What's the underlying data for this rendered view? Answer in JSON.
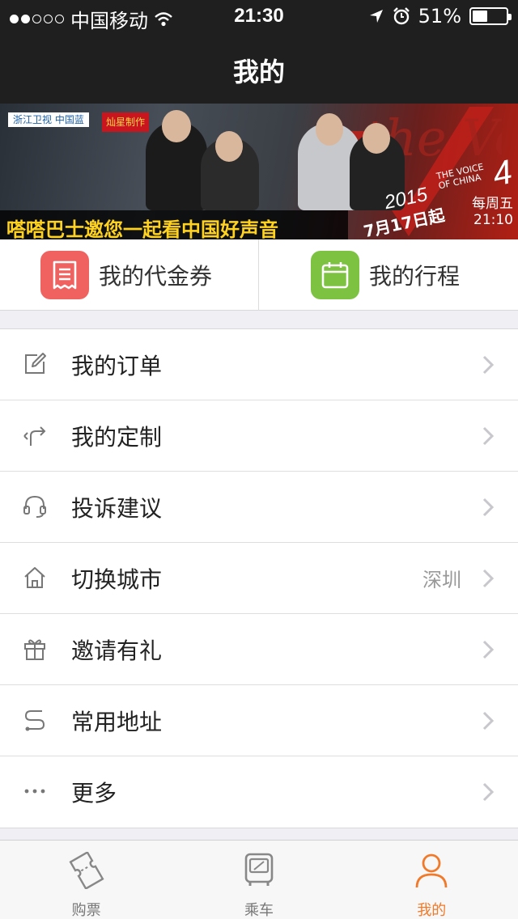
{
  "status_bar": {
    "carrier": "中国移动",
    "time": "21:30",
    "battery": "51%",
    "battery_level": 0.51
  },
  "navbar": {
    "title": "我的"
  },
  "banner": {
    "logo_left": "浙江卫视 中国蓝",
    "logo_right": "灿星制作",
    "caption": "嗒嗒巴士邀您一起看中国好声音",
    "show_word": "the Voice",
    "year": "2015",
    "show_name": "THE VOICE OF CHINA",
    "season": "4",
    "start_date": "7月17日起",
    "weekly_day": "每周五",
    "weekly_time": "21:10"
  },
  "quick_actions": [
    {
      "label": "我的代金券",
      "icon": "voucher-icon",
      "color": "#f0625f"
    },
    {
      "label": "我的行程",
      "icon": "calendar-icon",
      "color": "#7dc241"
    }
  ],
  "menu": [
    {
      "label": "我的订单",
      "icon": "edit-icon",
      "value": ""
    },
    {
      "label": "我的定制",
      "icon": "route-icon",
      "value": ""
    },
    {
      "label": "投诉建议",
      "icon": "headset-icon",
      "value": ""
    },
    {
      "label": "切换城市",
      "icon": "home-icon",
      "value": "深圳"
    },
    {
      "label": "邀请有礼",
      "icon": "gift-icon",
      "value": ""
    },
    {
      "label": "常用地址",
      "icon": "path-icon",
      "value": ""
    },
    {
      "label": "更多",
      "icon": "more-icon",
      "value": ""
    }
  ],
  "tabs": [
    {
      "label": "购票",
      "icon": "ticket-icon",
      "active": false
    },
    {
      "label": "乘车",
      "icon": "bus-icon",
      "active": false
    },
    {
      "label": "我的",
      "icon": "person-icon",
      "active": true
    }
  ],
  "colors": {
    "accent": "#f07a2a",
    "header_bg": "#1f1f1f",
    "page_bg": "#efeff4"
  }
}
